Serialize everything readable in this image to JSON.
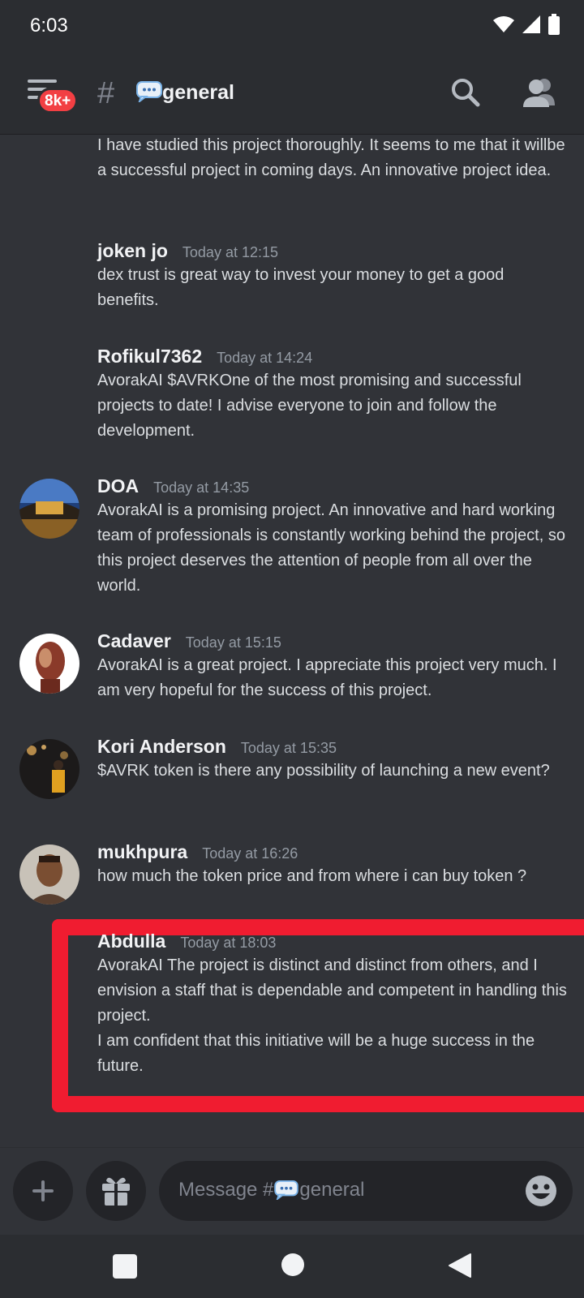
{
  "status": {
    "time": "6:03"
  },
  "header": {
    "unread_badge": "8k+",
    "channel_name": "general"
  },
  "messages": [
    {
      "author": "",
      "time": "",
      "text": "I have studied this project thoroughly. It seems to me that it willbe a successful project in coming days. An innovative project idea."
    },
    {
      "author": "joken  jo",
      "time": "Today at 12:15",
      "text": "dex trust is great way to invest your money to get a good benefits."
    },
    {
      "author": "Rofikul7362",
      "time": "Today at 14:24",
      "text": "AvorakAI $AVRKOne of the most promising and successful projects to date! I advise everyone to join and follow the development."
    },
    {
      "author": "DOA",
      "time": "Today at 14:35",
      "text": "AvorakAI is a promising project. An innovative and hard working team of professionals is constantly working behind the project, so this project deserves the attention of people from all over the world."
    },
    {
      "author": "Cadaver",
      "time": "Today at 15:15",
      "text": "AvorakAI is a great project. I appreciate this project very much. I am very hopeful for the success of this project."
    },
    {
      "author": "Kori Anderson",
      "time": "Today at 15:35",
      "text": "$AVRK token is there any possibility of launching a new event?"
    },
    {
      "author": "mukhpura",
      "time": "Today at 16:26",
      "text": "how much the token price and from where i can buy token ?"
    },
    {
      "author": "Abdulla",
      "time": "Today at 18:03",
      "text": "AvorakAI The project is distinct and distinct from others, and I envision a staff that is dependable and competent in handling this project.",
      "text2": "I am confident that this initiative will be a huge success in the future."
    }
  ],
  "composer": {
    "placeholder_prefix": "Message #",
    "placeholder_channel": "general"
  },
  "colors": {
    "background": "#313338",
    "header": "#2b2d31",
    "highlight": "#f01c30",
    "badge": "#f23f43"
  }
}
